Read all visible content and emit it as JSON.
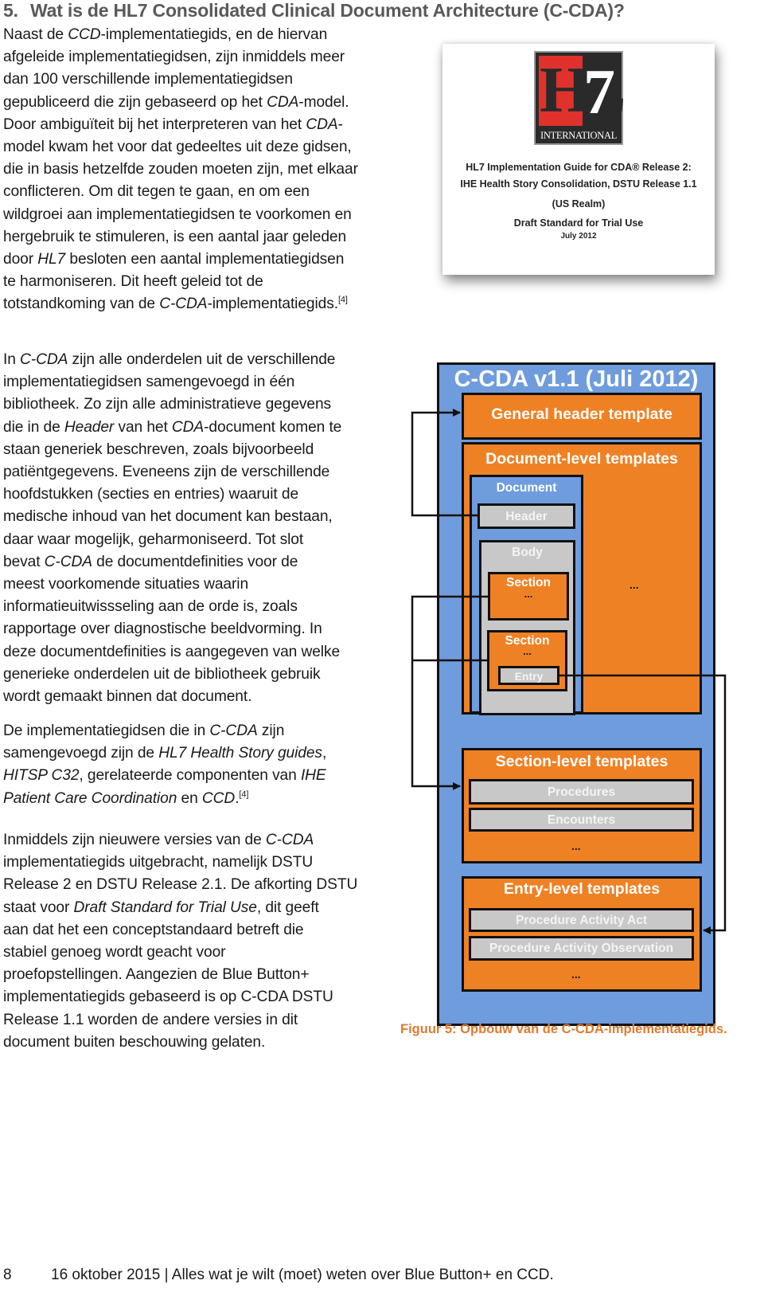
{
  "heading": {
    "number": "5.",
    "title": "Wat is de HL7 Consolidated Clinical Document Architecture (C-CDA)?"
  },
  "intro": {
    "lines": [
      [
        "Naast de ",
        {
          "i": "CCD"
        },
        "-implementatiegids, en de hiervan"
      ],
      [
        "afgeleide implementatiegidsen, zijn inmiddels meer"
      ],
      [
        "dan 100 verschillende implementatiegidsen"
      ],
      [
        "gepubliceerd die zijn gebaseerd op het ",
        {
          "i": "CDA"
        },
        "-model."
      ],
      [
        "Door ambiguïteit bij het interpreteren van het ",
        {
          "i": "CDA"
        },
        "-"
      ],
      [
        "model kwam het voor dat gedeeltes uit deze gidsen,"
      ],
      [
        "die in basis hetzelfde zouden moeten zijn, met elkaar"
      ],
      [
        "conflicteren. Om dit tegen te gaan, en om een"
      ],
      [
        "wildgroei aan implementatiegidsen te voorkomen en"
      ],
      [
        "hergebruik te stimuleren, is een aantal jaar geleden"
      ],
      [
        "door ",
        {
          "i": "HL7"
        },
        " besloten een aantal implementatiegidsen"
      ],
      [
        "te harmoniseren. Dit heeft geleid tot de"
      ],
      [
        "totstandkoming van de ",
        {
          "i": "C-CDA"
        },
        "-implementatiegids.",
        {
          "sup": "[4]"
        }
      ]
    ]
  },
  "cover_image": {
    "logo": {
      "letters": "HL",
      "digit": "7",
      "subtitle": "INTERNATIONAL"
    },
    "lines": [
      "HL7 Implementation Guide for CDA® Release 2:",
      "IHE Health Story Consolidation, DSTU Release 1.1",
      "(US Realm)",
      "Draft Standard for Trial Use",
      "July 2012"
    ]
  },
  "para2": {
    "lines": [
      [
        "In ",
        {
          "i": "C-CDA"
        },
        " zijn alle onderdelen uit de verschillende"
      ],
      [
        "implementatiegidsen samengevoegd in één"
      ],
      [
        "bibliotheek. Zo zijn alle administratieve gegevens"
      ],
      [
        "die in de ",
        {
          "i": "Header"
        },
        " van het ",
        {
          "i": "CDA"
        },
        "-document komen te"
      ],
      [
        "staan generiek beschreven, zoals bijvoorbeeld"
      ],
      [
        "patiëntgegevens. Eveneens zijn de verschillende"
      ],
      [
        "hoofdstukken (secties en entries) waaruit de"
      ],
      [
        "medische inhoud van het document kan bestaan,"
      ],
      [
        "daar waar mogelijk, geharmoniseerd. Tot slot"
      ],
      [
        "bevat ",
        {
          "i": "C-CDA"
        },
        " de documentdefinities voor de"
      ],
      [
        "meest voorkomende situaties waarin"
      ],
      [
        "informatieuitwissseling aan de orde is, zoals"
      ],
      [
        "rapportage over diagnostische beeldvorming. In"
      ],
      [
        "deze documentdefinities is aangegeven van welke"
      ],
      [
        "generieke onderdelen uit de bibliotheek gebruik"
      ],
      [
        "wordt gemaakt binnen dat document."
      ]
    ]
  },
  "para3": {
    "lines": [
      [
        "De implementatiegidsen die in ",
        {
          "i": "C-CDA"
        },
        " zijn"
      ],
      [
        "samengevoegd zijn de ",
        {
          "i": "HL7 Health Story guides"
        },
        ","
      ],
      [
        {
          "i": "HITSP C32"
        },
        ", gerelateerde componenten van ",
        {
          "i": "IHE"
        }
      ],
      [
        {
          "i": "Patient Care Coordination"
        },
        " en ",
        {
          "i": "CCD"
        },
        ".",
        {
          "sup": "[4]"
        }
      ]
    ]
  },
  "para4": {
    "lines": [
      [
        "Inmiddels zijn nieuwere versies van de ",
        {
          "i": "C-CDA"
        }
      ],
      [
        "implementatiegids uitgebracht, namelijk DSTU"
      ],
      [
        "Release 2 en DSTU Release 2.1. De afkorting DSTU"
      ],
      [
        "staat voor ",
        {
          "i": "Draft Standard for Trial Use"
        },
        ", dit geeft"
      ],
      [
        "aan dat het een conceptstandaard betreft die"
      ],
      [
        "stabiel genoeg wordt geacht voor"
      ],
      [
        "proefopstellingen. Aangezien de Blue Button+"
      ],
      [
        "implementatiegids gebaseerd is op C-CDA DSTU"
      ],
      [
        "Release 1.1 worden de andere versies in dit"
      ],
      [
        "document buiten beschouwing gelaten."
      ]
    ]
  },
  "diagram": {
    "title": "C-CDA v1.1 (Juli 2012)",
    "colors": {
      "outer": "#6f9cdc",
      "template": "#ef8125",
      "item": "#c8c8c8",
      "border": "#111111"
    },
    "general_header": "General header template",
    "document_level": {
      "title": "Document-level templates",
      "document": "Document",
      "header": "Header",
      "body": "Body",
      "section1": "Section",
      "section1_dots": "...",
      "section2": "Section",
      "section2_dots": "...",
      "entry": "Entry",
      "more": "..."
    },
    "section_level": {
      "title": "Section-level templates",
      "items": [
        "Procedures",
        "Encounters"
      ],
      "more": "..."
    },
    "entry_level": {
      "title": "Entry-level templates",
      "items": [
        "Procedure Activity Act",
        "Procedure Activity Observation"
      ],
      "more": "..."
    }
  },
  "caption": "Figuur 5: Opbouw van de C-CDA-implementatiegids.",
  "footer": {
    "page": "8",
    "text": "16 oktober 2015 | Alles wat je wilt (moet) weten over Blue Button+ en CCD."
  }
}
